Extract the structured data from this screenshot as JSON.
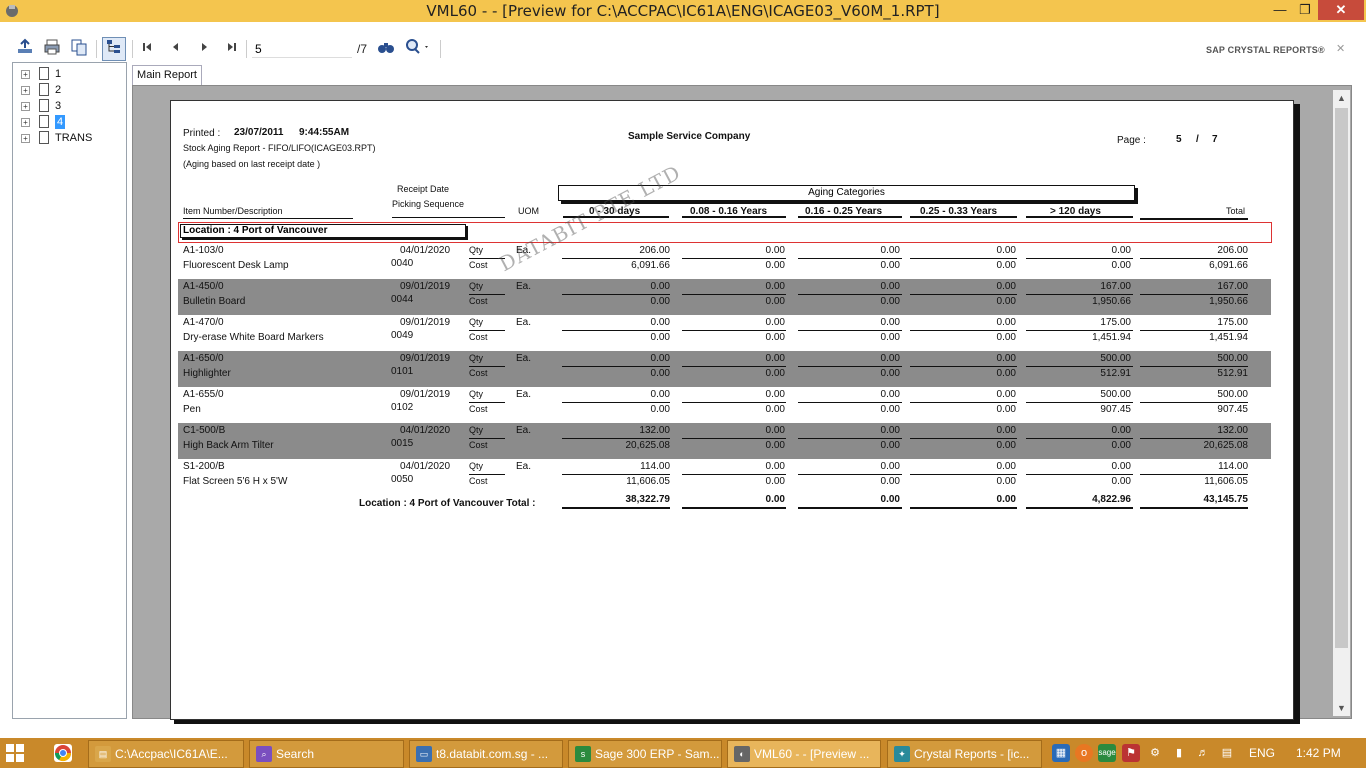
{
  "window": {
    "title": "VML60  -  - [Preview for C:\\ACCPAC\\IC61A\\ENG\\ICAGE03_V60M_1.RPT]",
    "minimize_icon": "minimize-icon",
    "maximize_icon": "restore-icon",
    "close_icon": "close-icon"
  },
  "toolbar": {
    "export_icon": "export-icon",
    "print_icon": "print-icon",
    "copy_icon": "copy-icon",
    "tree_toggle_icon": "group-tree-icon",
    "first_icon": "first-page-icon",
    "prev_icon": "previous-page-icon",
    "next_icon": "next-page-icon",
    "last_icon": "last-page-icon",
    "page_value": "5",
    "page_total": "/7",
    "find_icon": "binoculars-icon",
    "zoom_icon": "zoom-icon",
    "brand": "SAP CRYSTAL REPORTS®",
    "close_x": "✕"
  },
  "tree": {
    "items": [
      {
        "label": "1"
      },
      {
        "label": "2"
      },
      {
        "label": "3"
      },
      {
        "label": "4",
        "selected": true
      },
      {
        "label": "TRANS"
      }
    ]
  },
  "tab": {
    "label": "Main Report"
  },
  "report": {
    "printed_label": "Printed :",
    "printed_date": "23/07/2011",
    "printed_time": "9:44:55AM",
    "report_name": "Stock Aging Report - FIFO/LIFO(ICAGE03.RPT)",
    "aging_basis": "(Aging based on last receipt date )",
    "company": "Sample Service Company",
    "page_label": "Page :",
    "page_num": "5",
    "page_sep": "/",
    "page_total": "7",
    "headers": {
      "receipt_date": "Receipt Date",
      "picking_sequence": "Picking Sequence",
      "item": "Item Number/Description",
      "uom": "UOM",
      "aging_categories": "Aging Categories",
      "c1": "0 - 30 days",
      "c2": "0.08 - 0.16 Years",
      "c3": "0.16 - 0.25 Years",
      "c4": "0.25 - 0.33 Years",
      "c5": "> 120 days",
      "total": "Total"
    },
    "location_label": "Location : 4 Port of Vancouver",
    "watermark": "DATABIT PTE LTD",
    "rows": [
      {
        "item": "A1-103/0",
        "desc": "Fluorescent Desk Lamp",
        "date": "04/01/2020",
        "seq": "0040",
        "uom": "Ea.",
        "qty": [
          "206.00",
          "0.00",
          "0.00",
          "0.00",
          "0.00",
          "206.00"
        ],
        "cost": [
          "6,091.66",
          "0.00",
          "0.00",
          "0.00",
          "0.00",
          "6,091.66"
        ]
      },
      {
        "item": "A1-450/0",
        "desc": "Bulletin Board",
        "date": "09/01/2019",
        "seq": "0044",
        "uom": "Ea.",
        "qty": [
          "0.00",
          "0.00",
          "0.00",
          "0.00",
          "167.00",
          "167.00"
        ],
        "cost": [
          "0.00",
          "0.00",
          "0.00",
          "0.00",
          "1,950.66",
          "1,950.66"
        ]
      },
      {
        "item": "A1-470/0",
        "desc": "Dry-erase White Board Markers",
        "date": "09/01/2019",
        "seq": "0049",
        "uom": "Ea.",
        "qty": [
          "0.00",
          "0.00",
          "0.00",
          "0.00",
          "175.00",
          "175.00"
        ],
        "cost": [
          "0.00",
          "0.00",
          "0.00",
          "0.00",
          "1,451.94",
          "1,451.94"
        ]
      },
      {
        "item": "A1-650/0",
        "desc": "Highlighter",
        "date": "09/01/2019",
        "seq": "0101",
        "uom": "Ea.",
        "qty": [
          "0.00",
          "0.00",
          "0.00",
          "0.00",
          "500.00",
          "500.00"
        ],
        "cost": [
          "0.00",
          "0.00",
          "0.00",
          "0.00",
          "512.91",
          "512.91"
        ]
      },
      {
        "item": "A1-655/0",
        "desc": "Pen",
        "date": "09/01/2019",
        "seq": "0102",
        "uom": "Ea.",
        "qty": [
          "0.00",
          "0.00",
          "0.00",
          "0.00",
          "500.00",
          "500.00"
        ],
        "cost": [
          "0.00",
          "0.00",
          "0.00",
          "0.00",
          "907.45",
          "907.45"
        ]
      },
      {
        "item": "C1-500/B",
        "desc": "High Back Arm Tilter",
        "date": "04/01/2020",
        "seq": "0015",
        "uom": "Ea.",
        "qty": [
          "132.00",
          "0.00",
          "0.00",
          "0.00",
          "0.00",
          "132.00"
        ],
        "cost": [
          "20,625.08",
          "0.00",
          "0.00",
          "0.00",
          "0.00",
          "20,625.08"
        ]
      },
      {
        "item": "S1-200/B",
        "desc": "Flat Screen 5'6 H x 5'W",
        "date": "04/01/2020",
        "seq": "0050",
        "uom": "Ea.",
        "qty": [
          "114.00",
          "0.00",
          "0.00",
          "0.00",
          "0.00",
          "114.00"
        ],
        "cost": [
          "11,606.05",
          "0.00",
          "0.00",
          "0.00",
          "0.00",
          "11,606.05"
        ]
      }
    ],
    "qty_label": "Qty",
    "cost_label": "Cost",
    "total_label": "Location : 4 Port of Vancouver Total :",
    "totals": [
      "38,322.79",
      "0.00",
      "0.00",
      "0.00",
      "4,822.96",
      "43,145.75"
    ]
  },
  "taskbar": {
    "tasks": [
      {
        "label": "C:\\Accpac\\IC61A\\E...",
        "icon": "folder-icon"
      },
      {
        "label": "Search",
        "icon": "search-app-icon"
      },
      {
        "label": "t8.databit.com.sg - ...",
        "icon": "remote-desktop-icon"
      },
      {
        "label": "Sage 300 ERP - Sam...",
        "icon": "sage-icon"
      },
      {
        "label": "VML60  -  - [Preview ...",
        "icon": "app-icon",
        "active": true
      },
      {
        "label": "Crystal Reports - [ic...",
        "icon": "crystal-reports-icon"
      }
    ],
    "language": "ENG",
    "time": "1:42 PM"
  }
}
